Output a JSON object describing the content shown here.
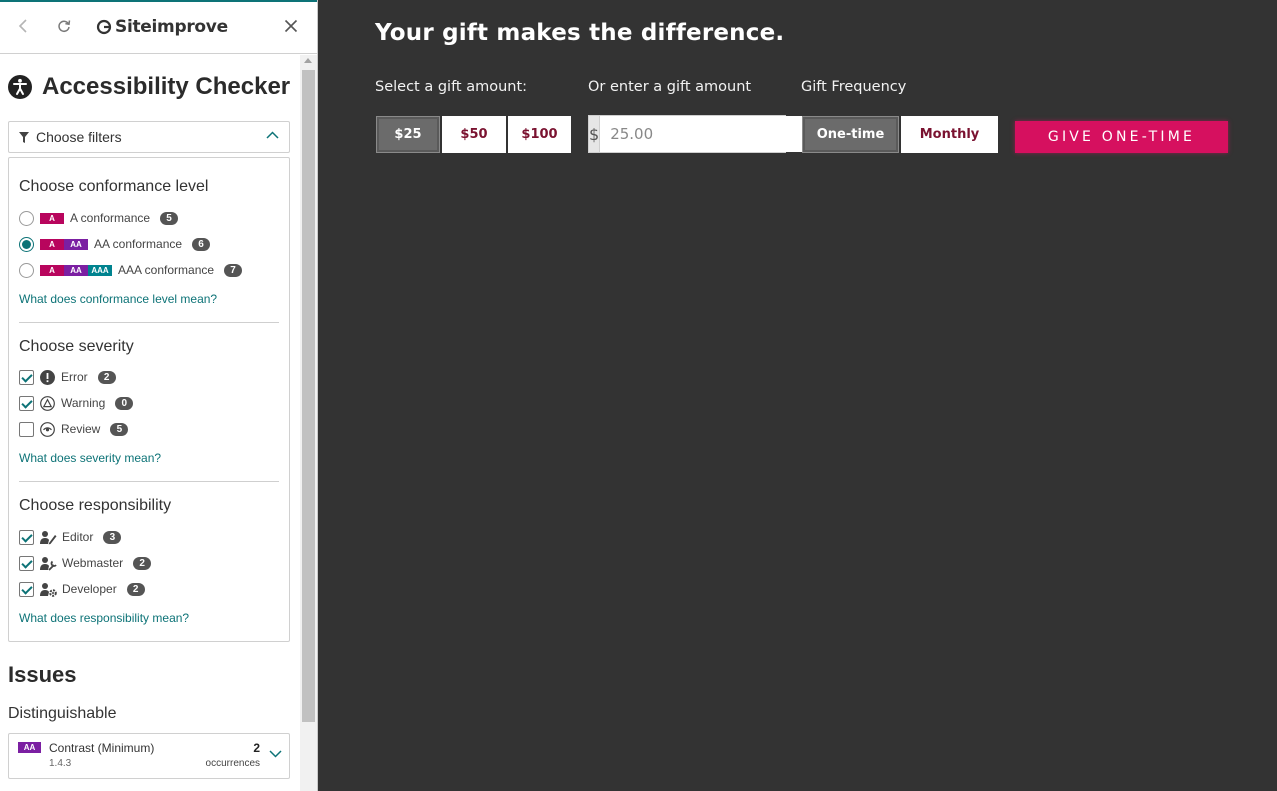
{
  "sidebar": {
    "logo_text": "Siteimprove",
    "title": "Accessibility Checker",
    "filter_toggle_label": "Choose filters",
    "conformance": {
      "title": "Choose conformance level",
      "options": [
        {
          "label": "A conformance",
          "count": "5",
          "levels": [
            "A"
          ],
          "selected": false
        },
        {
          "label": "AA conformance",
          "count": "6",
          "levels": [
            "A",
            "AA"
          ],
          "selected": true
        },
        {
          "label": "AAA conformance",
          "count": "7",
          "levels": [
            "A",
            "AA",
            "AAA"
          ],
          "selected": false
        }
      ],
      "help_link": "What does conformance level mean?"
    },
    "severity": {
      "title": "Choose severity",
      "options": [
        {
          "label": "Error",
          "count": "2",
          "checked": true,
          "icon": "error-icon"
        },
        {
          "label": "Warning",
          "count": "0",
          "checked": true,
          "icon": "warning-icon"
        },
        {
          "label": "Review",
          "count": "5",
          "checked": false,
          "icon": "review-icon"
        }
      ],
      "help_link": "What does severity mean?"
    },
    "responsibility": {
      "title": "Choose responsibility",
      "options": [
        {
          "label": "Editor",
          "count": "3",
          "checked": true,
          "icon": "editor-icon"
        },
        {
          "label": "Webmaster",
          "count": "2",
          "checked": true,
          "icon": "webmaster-icon"
        },
        {
          "label": "Developer",
          "count": "2",
          "checked": true,
          "icon": "developer-icon"
        }
      ],
      "help_link": "What does responsibility mean?"
    },
    "issues": {
      "title": "Issues",
      "group": "Distinguishable",
      "items": [
        {
          "level": "AA",
          "name": "Contrast (Minimum)",
          "code": "1.4.3",
          "count": "2",
          "count_label": "occurrences"
        }
      ]
    }
  },
  "donation": {
    "headline": "Your gift makes the difference.",
    "select_label": "Select a gift amount:",
    "enter_label": "Or enter a gift amount",
    "frequency_label": "Gift Frequency",
    "amounts": [
      "$25",
      "$50",
      "$100"
    ],
    "selected_amount": "$25",
    "currency_symbol": "$",
    "amount_value": "25.00",
    "frequencies": [
      "One-time",
      "Monthly"
    ],
    "selected_frequency": "One-time",
    "submit_label": "GIVE ONE-TIME"
  },
  "colors": {
    "accent": "#0d7377",
    "background": "#333333",
    "cta": "#d6105f",
    "amount_text": "#7a1230",
    "level_a": "#b8055d",
    "level_aa": "#7b1fa2",
    "level_aaa": "#00838f"
  }
}
